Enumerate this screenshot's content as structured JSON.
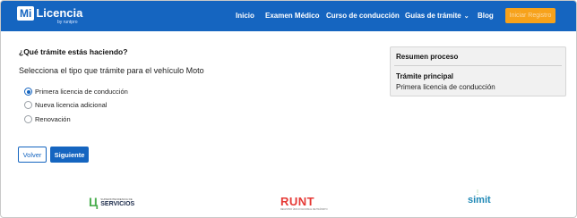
{
  "header": {
    "logo_mi": "Mi",
    "logo_text": "Licencia",
    "logo_sub": "by runtpro",
    "nav": [
      {
        "label": "Inicio"
      },
      {
        "label": "Examen Médico"
      },
      {
        "label": "Curso de conducción"
      },
      {
        "label": "Guías de trámite",
        "has_dropdown": true
      },
      {
        "label": "Blog"
      }
    ],
    "login_button": "Iniciar Registro"
  },
  "main": {
    "question": "¿Qué trámite estás haciendo?",
    "instruction": "Selecciona el tipo que trámite para el vehículo Moto",
    "options": [
      {
        "label": "Primera licencia de conducción",
        "selected": true
      },
      {
        "label": "Nueva licencia adicional",
        "selected": false
      },
      {
        "label": "Renovación",
        "selected": false
      }
    ],
    "back_button": "Volver",
    "next_button": "Siguiente"
  },
  "summary": {
    "title": "Resumen proceso",
    "label": "Trámite principal",
    "value": "Primera licencia de conducción"
  },
  "footer": {
    "logo1_small": "SUPERINTENDENCIA DE",
    "logo1_big": "SERVICIOS",
    "logo2": "RUNT",
    "logo2_sub": "REGISTRO ÚNICO NACIONAL DE TRÁNSITO",
    "logo3": "simit"
  },
  "colors": {
    "brand": "#1565c0",
    "accent": "#f7a21b"
  }
}
